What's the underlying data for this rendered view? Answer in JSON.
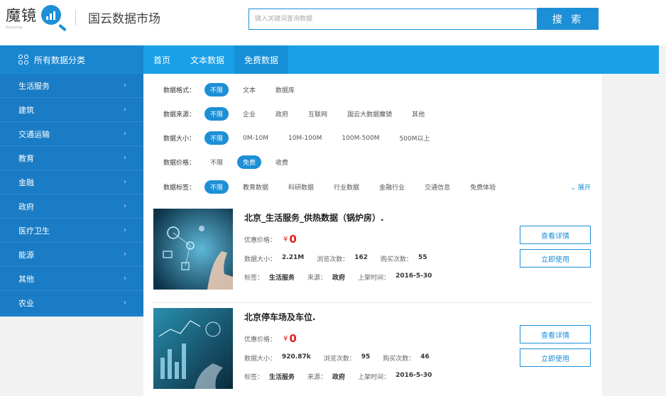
{
  "header": {
    "logo_text": "魔镜",
    "logo_sub": "moojing",
    "site_title": "国云数据市场",
    "search_placeholder": "键入关键词查询数据",
    "search_button": "搜 索"
  },
  "nav": {
    "category_label": "所有数据分类",
    "links": [
      "首页",
      "文本数据",
      "免费数据"
    ]
  },
  "sidebar": {
    "items": [
      "生活服务",
      "建筑",
      "交通运输",
      "教育",
      "金融",
      "政府",
      "医疗卫生",
      "能源",
      "其他",
      "农业"
    ]
  },
  "filters": {
    "format": {
      "label": "数据格式：",
      "options": [
        "不限",
        "文本",
        "数据库"
      ]
    },
    "source": {
      "label": "数据来源：",
      "options": [
        "不限",
        "企业",
        "政府",
        "互联网",
        "国云大数据魔镜",
        "其他"
      ]
    },
    "size": {
      "label": "数据大小：",
      "options": [
        "不限",
        "0M-10M",
        "10M-100M",
        "100M-500M",
        "500M以上"
      ]
    },
    "price": {
      "label": "数据价格：",
      "options": [
        "不限",
        "免费",
        "收费"
      ]
    },
    "tags": {
      "label": "数据标签：",
      "options": [
        "不限",
        "教育数据",
        "科研数据",
        "行业数据",
        "金融行业",
        "交通信息",
        "免费体验"
      ]
    },
    "expand_label": "展开"
  },
  "datasets": [
    {
      "title": "北京_生活服务_供热数据（锅炉房）.",
      "price_label": "优惠价格：",
      "price_currency": "¥",
      "price_value": "0",
      "size_label": "数据大小：",
      "size_value": "2.21M",
      "views_label": "浏览次数：",
      "views_value": "162",
      "buys_label": "购买次数：",
      "buys_value": "55",
      "tag_label": "标签：",
      "tag_value": "生活服务",
      "source_label": "来源：",
      "source_value": "政府",
      "date_label": "上架时间：",
      "date_value": "2016-5-30",
      "detail_button": "查看详情",
      "use_button": "立即使用"
    },
    {
      "title": "北京停车场及车位.",
      "price_label": "优惠价格：",
      "price_currency": "¥",
      "price_value": "0",
      "size_label": "数据大小：",
      "size_value": "920.87k",
      "views_label": "浏览次数：",
      "views_value": "95",
      "buys_label": "购买次数：",
      "buys_value": "46",
      "tag_label": "标签：",
      "tag_value": "生活服务",
      "source_label": "来源：",
      "source_value": "政府",
      "date_label": "上架时间：",
      "date_value": "2016-5-30",
      "detail_button": "查看详情",
      "use_button": "立即使用"
    }
  ],
  "colors": {
    "brand_blue": "#1d8fd6",
    "nav_blue": "#1aa0e8",
    "sidebar_blue": "#1a7cc4",
    "price_red": "#e02020"
  }
}
